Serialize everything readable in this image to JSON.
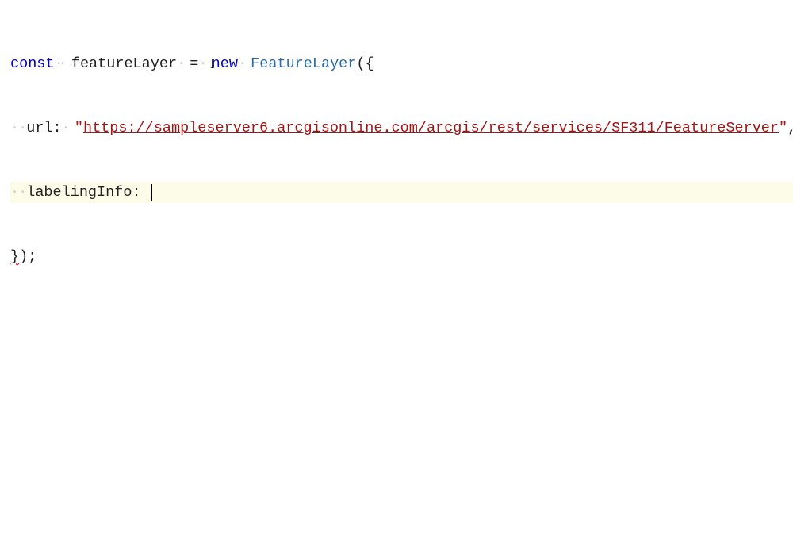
{
  "code": {
    "line1": {
      "keyword": "const",
      "variable": "featureLayer",
      "operator": "=",
      "new": "new",
      "class": "FeatureLayer",
      "open": "({"
    },
    "line2": {
      "prop": "url",
      "colon": ":",
      "string_open": "\"",
      "url": "https://sampleserver6.arcgisonline.com/arcgis/rest/services/SF311/FeatureServer",
      "string_close": "\"",
      "comma": ","
    },
    "line3": {
      "prop": "labelingInfo",
      "colon": ":"
    },
    "line4": {
      "close": "});"
    },
    "whitespace_dots": "··"
  }
}
